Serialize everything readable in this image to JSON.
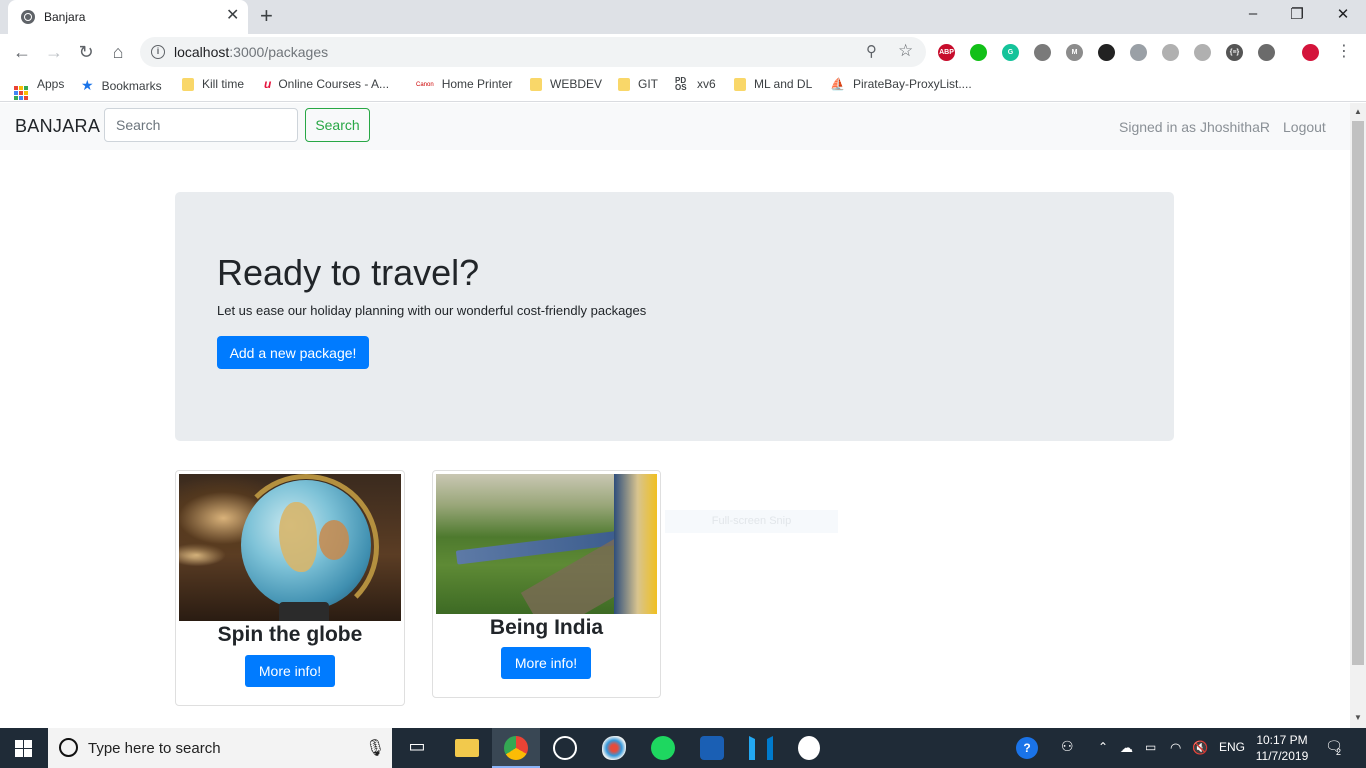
{
  "browser": {
    "tab_title": "Banjara",
    "tab_close": "✕",
    "new_tab": "+",
    "window_controls": {
      "minimize": "–",
      "restore": "❐",
      "close": "✕"
    },
    "url_host": "localhost",
    "url_path": ":3000/packages",
    "info_glyph": "i",
    "extensions": [
      {
        "name": "adblock-plus-icon",
        "label": "ABP",
        "color": "#c70d2c"
      },
      {
        "name": "hangouts-icon",
        "label": "",
        "color": "#12c018"
      },
      {
        "name": "grammarly-icon",
        "label": "G",
        "color": "#15c39a"
      },
      {
        "name": "extension-icon",
        "label": "",
        "color": "#7a7a7a"
      },
      {
        "name": "mailtrack-icon",
        "label": "M",
        "color": "#8c8c8c"
      },
      {
        "name": "tab-icon",
        "label": "",
        "color": "#222222"
      },
      {
        "name": "extension-icon",
        "label": "",
        "color": "#9aa0a6"
      },
      {
        "name": "globe-ext-icon",
        "label": "",
        "color": "#b0b0b0"
      },
      {
        "name": "copy-ext-icon",
        "label": "",
        "color": "#b0b0b0"
      },
      {
        "name": "json-ext-icon",
        "label": "{≡}",
        "color": "#555555"
      },
      {
        "name": "ghost-ext-icon",
        "label": "",
        "color": "#6b6b6b"
      },
      {
        "name": "profile-avatar-icon",
        "label": "",
        "color": "#d4143b"
      }
    ],
    "bookmarks": [
      {
        "label": "Apps",
        "icon": "apps-grid-icon"
      },
      {
        "label": "Bookmarks",
        "icon": "star-icon"
      },
      {
        "label": "Kill time",
        "icon": "folder-icon"
      },
      {
        "label": "Online Courses - A...",
        "icon": "udemy-icon"
      },
      {
        "label": "Home Printer",
        "icon": "canon-icon"
      },
      {
        "label": "WEBDEV",
        "icon": "folder-icon"
      },
      {
        "label": "GIT",
        "icon": "folder-icon"
      },
      {
        "label": "xv6",
        "icon": "pdos-icon"
      },
      {
        "label": "ML and DL",
        "icon": "folder-icon"
      },
      {
        "label": "PirateBay-ProxyList....",
        "icon": "pirate-ship-icon"
      }
    ],
    "pdos_label": "PD\nOS",
    "canon_label": "Canon"
  },
  "site": {
    "brand": "BANJARA",
    "search_placeholder": "Search",
    "search_button": "Search",
    "signed_in": "Signed in as JhoshithaR",
    "logout": "Logout"
  },
  "jumbotron": {
    "title": "Ready to travel?",
    "lead": "Let us ease our holiday planning with our wonderful cost-friendly packages",
    "button": "Add a new package!"
  },
  "packages": [
    {
      "title": "Spin the globe",
      "button": "More info!"
    },
    {
      "title": "Being India",
      "button": "More info!"
    }
  ],
  "overlay": {
    "snip_label": "Full-screen Snip"
  },
  "taskbar": {
    "search_placeholder": "Type here to search",
    "language": "ENG",
    "time": "10:17 PM",
    "date": "11/7/2019",
    "notification_count": "2"
  },
  "colors": {
    "primary": "#007bff",
    "success": "#28a745",
    "jumbotron_bg": "#e9ecef",
    "taskbar_bg": "#1f2b37"
  }
}
